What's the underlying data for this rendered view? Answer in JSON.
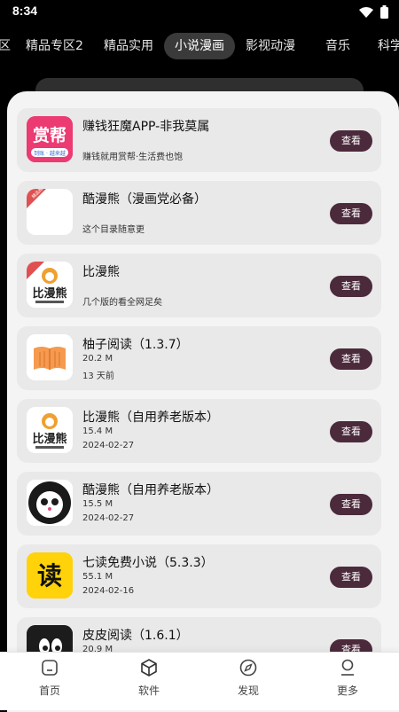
{
  "status_bar": {
    "time": "8:34"
  },
  "tabs": [
    {
      "label": "区"
    },
    {
      "label": "精品专区2"
    },
    {
      "label": "精品实用"
    },
    {
      "label": "小说漫画"
    },
    {
      "label": "影视动漫"
    },
    {
      "label": "音乐"
    },
    {
      "label": "科学"
    }
  ],
  "active_tab": "小说漫画",
  "apps": [
    {
      "title": "赚钱狂魔APP-非我莫属",
      "lines": [
        "赚钱就用赏帮·生活费也饱"
      ],
      "button": "查看",
      "icon": "shangbang-app-icon",
      "icon_text": "赏帮",
      "icon_subtext": "到账 · 越来越"
    },
    {
      "title": "酷漫熊（漫画党必备）",
      "lines": [
        "这个目录随意更"
      ],
      "button": "查看",
      "icon": "kumanxiong-app-icon",
      "icon_text": "精品推荐"
    },
    {
      "title": "比漫熊",
      "lines": [
        "几个版的看全网足矣"
      ],
      "button": "查看",
      "icon": "bimanxiong-app-icon",
      "icon_text": "比漫熊"
    },
    {
      "title": "柚子阅读（1.3.7）",
      "lines": [
        "20.2 M",
        "13 天前"
      ],
      "button": "查看",
      "icon": "book-app-icon"
    },
    {
      "title": "比漫熊（自用养老版本）",
      "lines": [
        "15.4 M",
        "2024-02-27"
      ],
      "button": "查看",
      "icon": "bimanxiong-app-icon",
      "icon_text": "比漫熊"
    },
    {
      "title": "酷漫熊（自用养老版本）",
      "lines": [
        "15.5 M",
        "2024-02-27"
      ],
      "button": "查看",
      "icon": "kumanxiong-panda-icon"
    },
    {
      "title": "七读免费小说（5.3.3）",
      "lines": [
        "55.1 M",
        "2024-02-16"
      ],
      "button": "查看",
      "icon": "qidu-app-icon",
      "icon_text": "读"
    },
    {
      "title": "皮皮阅读（1.6.1）",
      "lines": [
        "20.9 M"
      ],
      "button": "查看",
      "icon": "pipi-app-icon"
    }
  ],
  "bottom_nav": [
    {
      "label": "首页",
      "icon": "home-icon"
    },
    {
      "label": "软件",
      "icon": "box-icon"
    },
    {
      "label": "发现",
      "icon": "compass-icon"
    },
    {
      "label": "更多",
      "icon": "user-icon"
    }
  ],
  "colors": {
    "accent": "#4b2a3b",
    "background": "#000000",
    "panel": "#f4f4f4",
    "card": "#e9e9e9"
  }
}
